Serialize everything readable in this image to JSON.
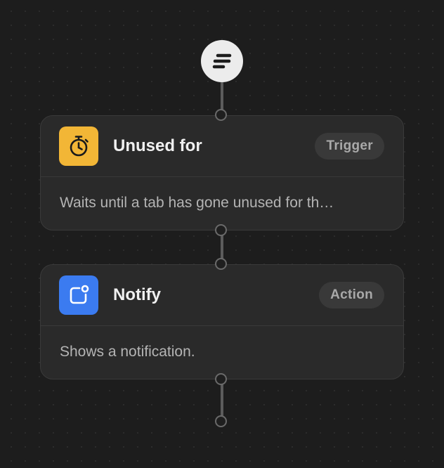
{
  "workflow": {
    "start_icon": "flow-lines-icon",
    "nodes": [
      {
        "title": "Unused for",
        "badge": "Trigger",
        "description": "Waits until a tab has gone unused for th…",
        "icon": "stopwatch-icon",
        "icon_color": "#F2B636"
      },
      {
        "title": "Notify",
        "badge": "Action",
        "description": "Shows a notification.",
        "icon": "notification-badge-icon",
        "icon_color": "#3B7BF0"
      }
    ]
  },
  "colors": {
    "background": "#1d1d1d",
    "card": "#2a2a2a",
    "badge": "#393939",
    "connector": "#5c5c5c"
  }
}
